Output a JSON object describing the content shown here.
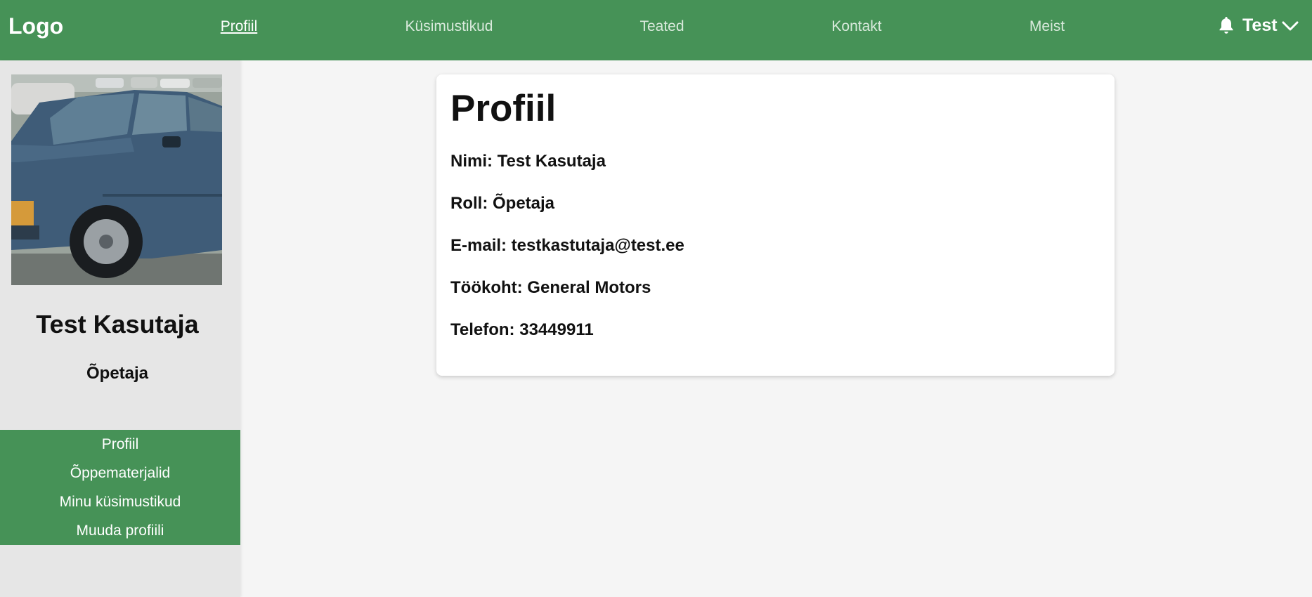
{
  "header": {
    "logo": "Logo",
    "nav": [
      {
        "label": "Profiil",
        "active": true
      },
      {
        "label": "Küsimustikud"
      },
      {
        "label": "Teated"
      },
      {
        "label": "Kontakt"
      },
      {
        "label": "Meist"
      }
    ],
    "notifications_icon": "bell-icon",
    "user_label": "Test",
    "user_menu_icon": "chevron-down-icon"
  },
  "sidebar": {
    "avatar_alt": "car-photo",
    "name": "Test Kasutaja",
    "role": "Õpetaja",
    "menu": [
      {
        "label": "Profiil"
      },
      {
        "label": "Õppematerjalid"
      },
      {
        "label": "Minu küsimustikud"
      },
      {
        "label": "Muuda profiili"
      }
    ]
  },
  "profile": {
    "title": "Profiil",
    "fields": [
      {
        "text": "Nimi: Test Kasutaja"
      },
      {
        "text": "Roll: Õpetaja"
      },
      {
        "text": "E-mail: testkastutaja@test.ee"
      },
      {
        "text": "Töökoht: General Motors"
      },
      {
        "text": "Telefon: 33449911"
      }
    ]
  },
  "colors": {
    "brand_green": "#469257",
    "page_bg": "#f5f5f5",
    "sidebar_bg": "#e6e6e6"
  }
}
